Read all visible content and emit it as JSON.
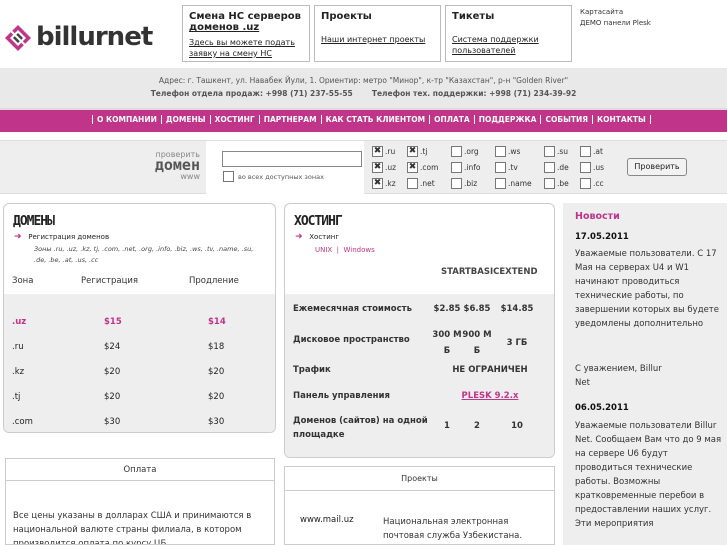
{
  "logo": {
    "text": "billurnet"
  },
  "top_boxes": [
    {
      "title": "Смена НС серверов",
      "title_link": "доменов .uz",
      "desc": "Здесь вы можете подать заявку на смену НС серверов"
    },
    {
      "title": "Проекты",
      "desc": "Наши интернет проекты"
    },
    {
      "title": "Тикеты",
      "desc": "Система поддержки пользователей"
    }
  ],
  "side_links": [
    "Картасайта",
    "ДЕМО панели Plesk"
  ],
  "info": {
    "address": "Адрес: г. Ташкент, ул. Навабек Йули, 1. Ориентир: метро \"Минор\", к-тр \"Казахстан\", р-н \"Golden River\"",
    "phone_sales": "Телефон отдела продаж: +998 (71) 237-55-55",
    "phone_support": "Телефон тех. поддержки: +998 (71) 234-39-92"
  },
  "nav": [
    "О КОМПАНИИ",
    "ДОМЕНЫ",
    "ХОСТИНГ",
    "ПАРТНЕРАМ",
    "КАК СТАТЬ КЛИЕНТОМ",
    "ОПЛАТА",
    "ПОДДЕРЖКА",
    "СОБЫТИЯ",
    "КОНТАКТЫ"
  ],
  "check": {
    "cap1": "проверить",
    "cap2": "домен",
    "cap3": "www",
    "all_free": "во всех доступных зонах",
    "button": "Проверить",
    "zones": [
      {
        "z": ".ru",
        "on": true
      },
      {
        "z": ".tj",
        "on": true
      },
      {
        "z": ".org",
        "on": false
      },
      {
        "z": ".ws",
        "on": false
      },
      {
        "z": ".su",
        "on": false
      },
      {
        "z": ".at",
        "on": false
      },
      {
        "z": ".uz",
        "on": true
      },
      {
        "z": ".com",
        "on": true
      },
      {
        "z": ".info",
        "on": false
      },
      {
        "z": ".tv",
        "on": false
      },
      {
        "z": ".de",
        "on": false
      },
      {
        "z": ".us",
        "on": false
      },
      {
        "z": ".kz",
        "on": true
      },
      {
        "z": ".net",
        "on": false
      },
      {
        "z": ".biz",
        "on": false
      },
      {
        "z": ".name",
        "on": false
      },
      {
        "z": ".be",
        "on": false
      },
      {
        "z": ".cc",
        "on": false
      }
    ]
  },
  "domains": {
    "title": "ДОМЕНЫ",
    "sub": "Регистрация доменов",
    "zones_line": "Зоны .ru, .uz, .kz, tj, .com, .net, .org, .info, .biz, .ws, .tv, .name, .su, .de, .be, .at, .us, .cc",
    "headers": [
      "Зона",
      "Регистрация",
      "Продление"
    ],
    "rows": [
      [
        ".uz",
        "$15",
        "$14"
      ],
      [
        ".ru",
        "$24",
        "$18"
      ],
      [
        ".kz",
        "$20",
        "$20"
      ],
      [
        ".tj",
        "$20",
        "$20"
      ],
      [
        ".com",
        "$30",
        "$30"
      ]
    ]
  },
  "hosting": {
    "title": "ХОСТИНГ",
    "sub": "Хостинг",
    "os": [
      "UNIX",
      "Windows"
    ],
    "plans": "STARTBASICEXTEND",
    "rows": [
      {
        "label": "Ежемесячная стоимость",
        "vals": [
          "$2.85",
          "$6.85",
          "$14.85"
        ]
      },
      {
        "label": "Дисковое пространство",
        "vals": [
          "300 М Б",
          "900 М Б",
          "3 ГБ"
        ]
      },
      {
        "label": "Трафик",
        "merged": "НЕ ОГРАНИЧЕН"
      },
      {
        "label": "Панель управления",
        "merged": "PLESK 9.2.x"
      },
      {
        "label": "Доменов (сайтов) на одной площадке",
        "vals": [
          "1",
          "2",
          "10"
        ]
      }
    ]
  },
  "news": {
    "title": "Новости",
    "items": [
      {
        "date": "17.05.2011",
        "text": "Уважаемые пользователи. С 17 Мая на серверах U4 и W1 начинают проводиться технические работы, по завершении которых вы будете уведомлены дополнительно",
        "sign": "С уважением, Billur Net"
      },
      {
        "date": "06.05.2011",
        "text": "Уважаемые пользователи Billur Net. Сообщаем Вам что до 9 мая на сервере U6 будут проводиться технические работы. Возможны кратковременные перебои в предоставлении наших услуг. Эти мероприятия"
      }
    ]
  },
  "payment": {
    "title": "Оплата",
    "text": "Все цены указаны в долларах США и принимаются в национальной валюте страны филиала, в котором производится оплата по курсу ЦБ."
  },
  "projects": {
    "title": "Проекты",
    "site": "www.mail.uz",
    "desc": "Национальная электронная почтовая служба Узбекистана."
  },
  "colors": {
    "accent": "#c0348a",
    "nav_bg": "#c0348a"
  }
}
